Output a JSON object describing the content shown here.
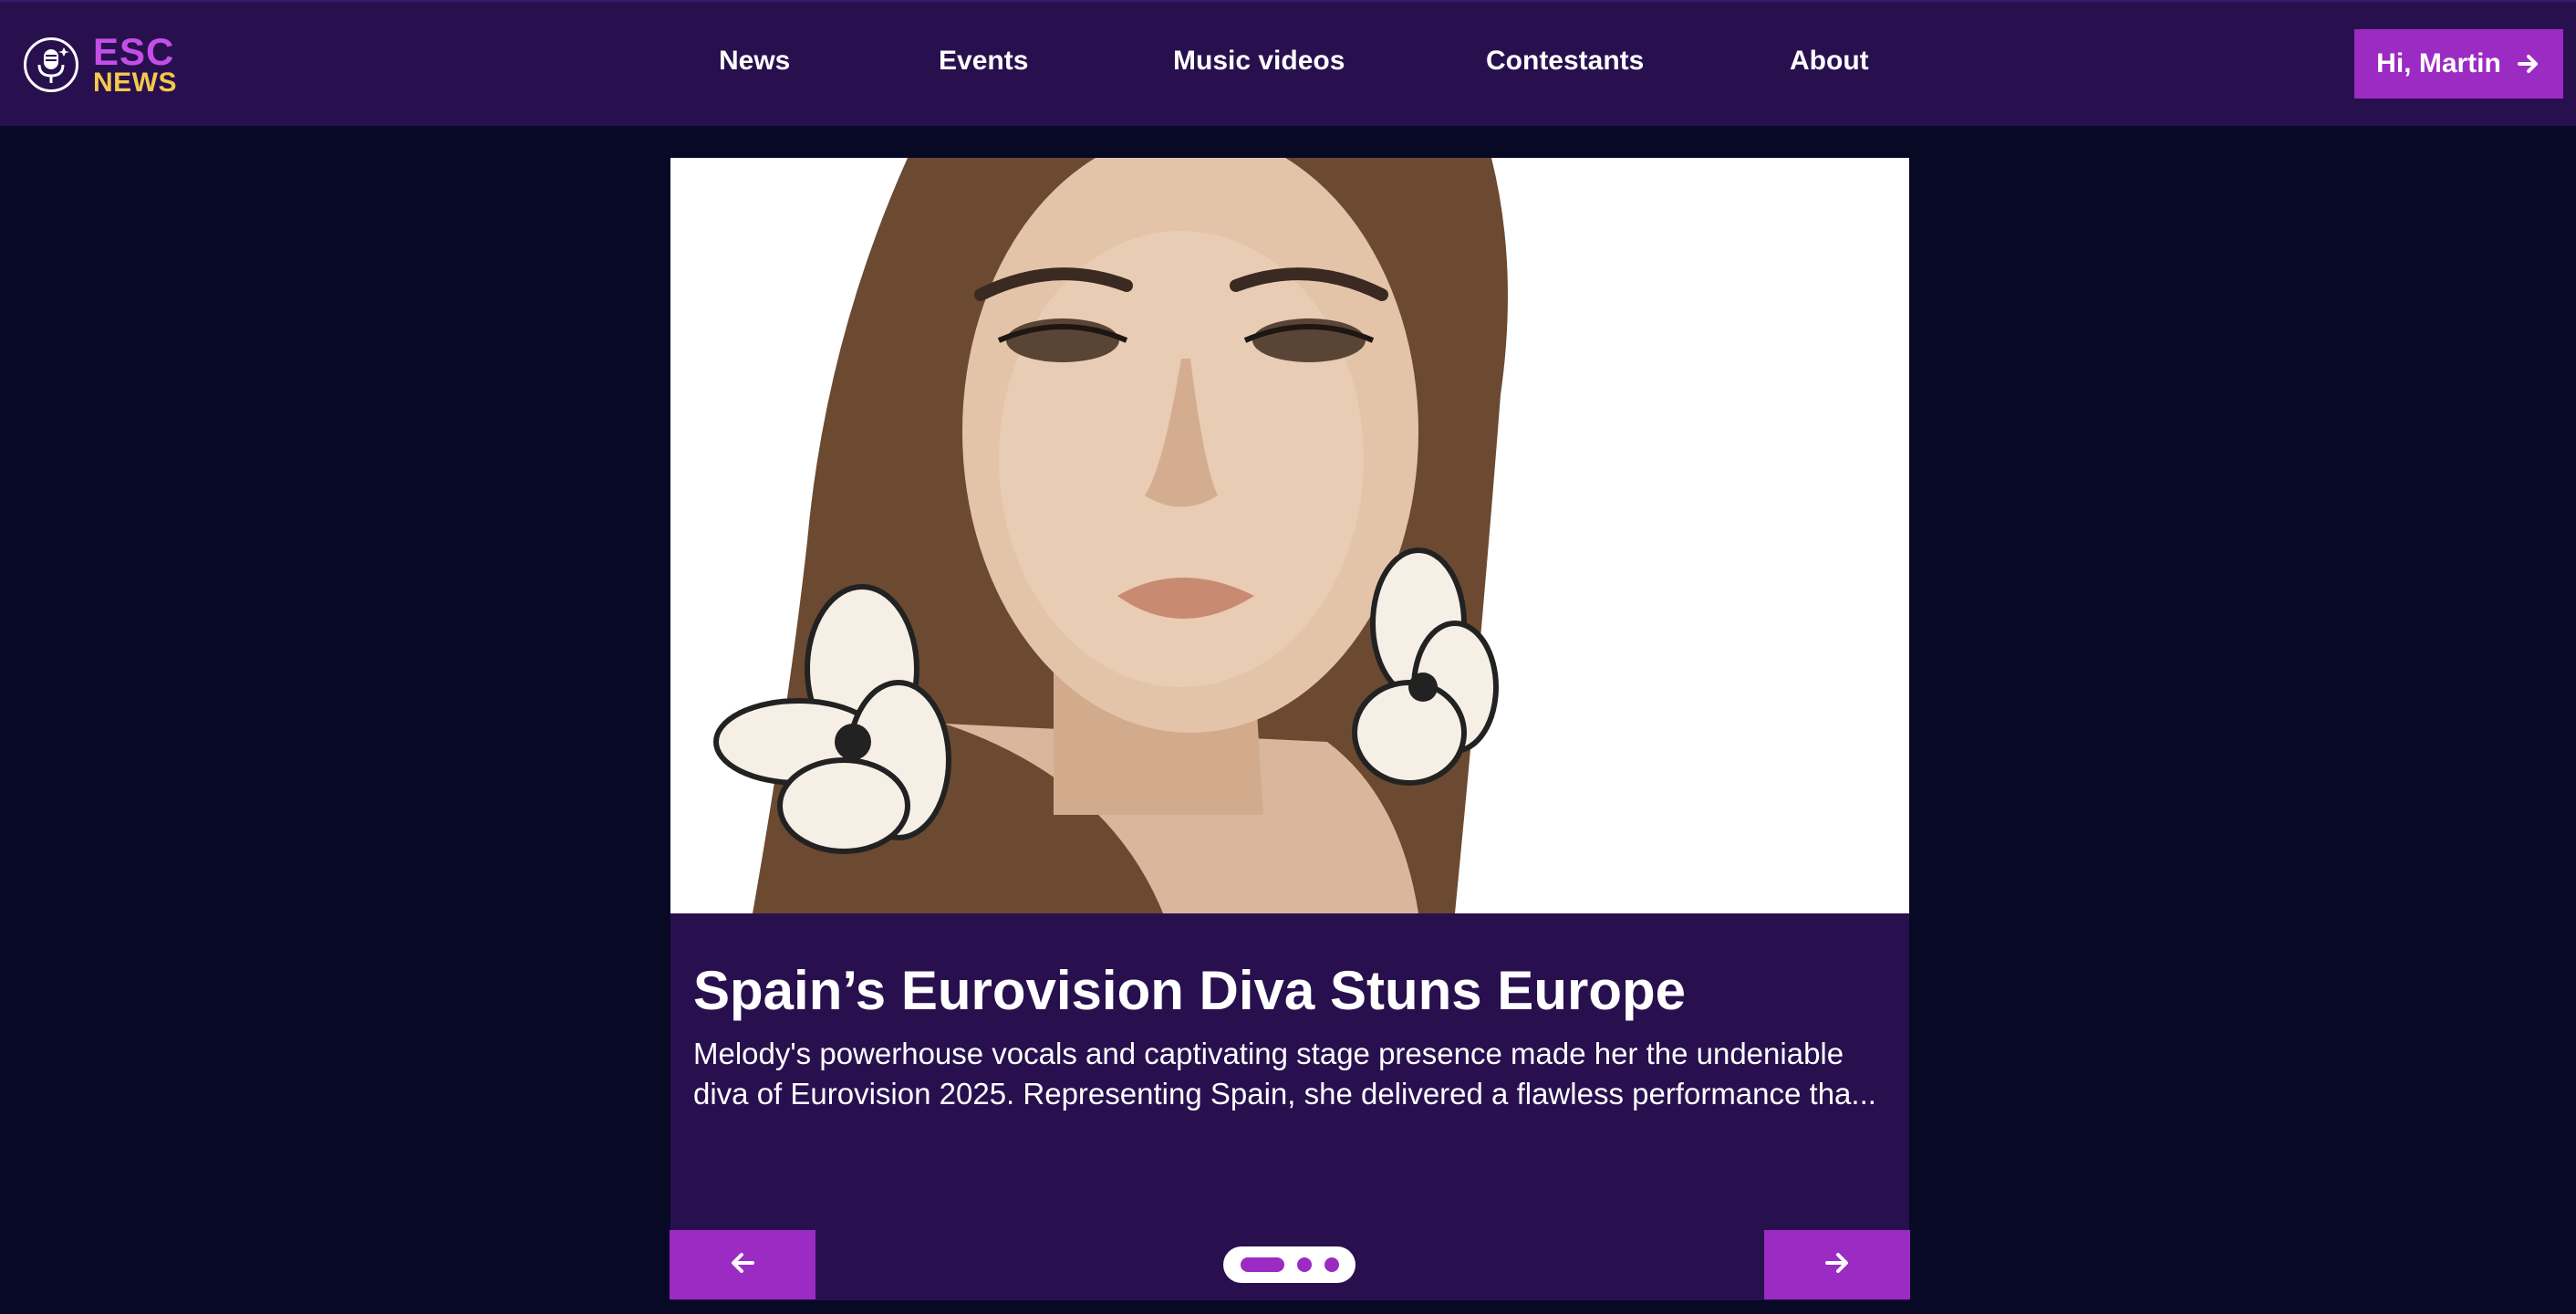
{
  "brand": {
    "line1": "ESC",
    "line2": "NEWS"
  },
  "nav": {
    "items": [
      {
        "label": "News"
      },
      {
        "label": "Events"
      },
      {
        "label": "Music videos"
      },
      {
        "label": "Contestants"
      },
      {
        "label": "About"
      }
    ]
  },
  "user": {
    "greeting": "Hi, Martin"
  },
  "slide": {
    "title": "Spain’s Eurovision Diva Stuns Europe",
    "description": "Melody's powerhouse vocals and captivating stage presence made her the undeniable diva of Eurovision 2025. Representing Spain, she delivered a flawless performance tha..."
  },
  "carousel": {
    "total": 3,
    "active": 1
  },
  "colors": {
    "background": "#070925",
    "header": "#28104f",
    "accent": "#9b2bc2",
    "brand_primary": "#c54ee8",
    "brand_secondary": "#f5c84c"
  }
}
